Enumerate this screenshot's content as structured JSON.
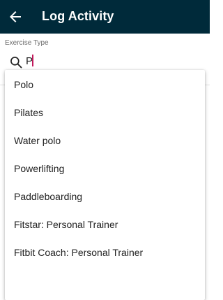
{
  "appbar": {
    "title": "Log Activity",
    "back_icon": "arrow-left-icon",
    "background": "#002a3a"
  },
  "form": {
    "field_label": "Exercise Type",
    "search_icon": "search-icon",
    "search_value": "P",
    "accent_color": "#c2185b"
  },
  "dropdown": {
    "items": [
      "Polo",
      "Pilates",
      "Water polo",
      "Powerlifting",
      "Paddleboarding",
      "Fitstar: Personal Trainer",
      "Fitbit Coach: Personal Trainer"
    ]
  }
}
